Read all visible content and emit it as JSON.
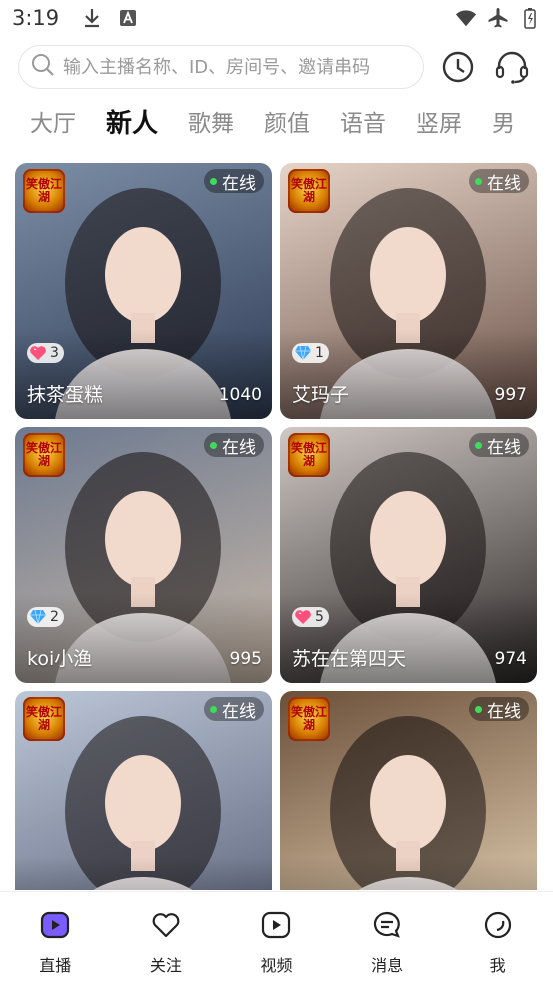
{
  "status_bar": {
    "time": "3:19"
  },
  "search": {
    "placeholder": "输入主播名称、ID、房间号、邀请串码"
  },
  "tabs": [
    {
      "label": "大厅",
      "active": false
    },
    {
      "label": "新人",
      "active": true
    },
    {
      "label": "歌舞",
      "active": false
    },
    {
      "label": "颜值",
      "active": false
    },
    {
      "label": "语音",
      "active": false
    },
    {
      "label": "竖屏",
      "active": false
    },
    {
      "label": "男",
      "active": false
    }
  ],
  "logo_text": "笑傲江湖",
  "cards": [
    {
      "name": "抹茶蛋糕",
      "count": "1040",
      "status": "在线",
      "level": "3",
      "badge": "heart",
      "bg_top": "#7c8da6",
      "bg_bottom": "#2f3d55"
    },
    {
      "name": "艾玛子",
      "count": "997",
      "status": "在线",
      "level": "1",
      "badge": "diamond",
      "bg_top": "#e6d4c8",
      "bg_bottom": "#6b5147"
    },
    {
      "name": "koi小渔",
      "count": "995",
      "status": "在线",
      "level": "2",
      "badge": "diamond",
      "bg_top": "#6d7a90",
      "bg_bottom": "#c9b8a8"
    },
    {
      "name": "苏在在第四天",
      "count": "974",
      "status": "在线",
      "level": "5",
      "badge": "heart",
      "bg_top": "#cfc8c4",
      "bg_bottom": "#2c2727"
    },
    {
      "name": "",
      "count": "",
      "status": "在线",
      "level": "",
      "badge": "diamond",
      "bg_top": "#bcc7d8",
      "bg_bottom": "#5a6178"
    },
    {
      "name": "",
      "count": "",
      "status": "在线",
      "level": "",
      "badge": "diamond",
      "bg_top": "#6b4f3a",
      "bg_bottom": "#e9d6b8"
    }
  ],
  "nav": [
    {
      "label": "直播",
      "icon": "live-icon",
      "active": true
    },
    {
      "label": "关注",
      "icon": "heart-icon",
      "active": false
    },
    {
      "label": "视频",
      "icon": "play-icon",
      "active": false
    },
    {
      "label": "消息",
      "icon": "message-icon",
      "active": false
    },
    {
      "label": "我",
      "icon": "profile-icon",
      "active": false
    }
  ],
  "colors": {
    "accent": "#7a5cff",
    "online_dot": "#3ddc5a",
    "text": "#222222",
    "tab_inactive": "#8a8a8a"
  }
}
